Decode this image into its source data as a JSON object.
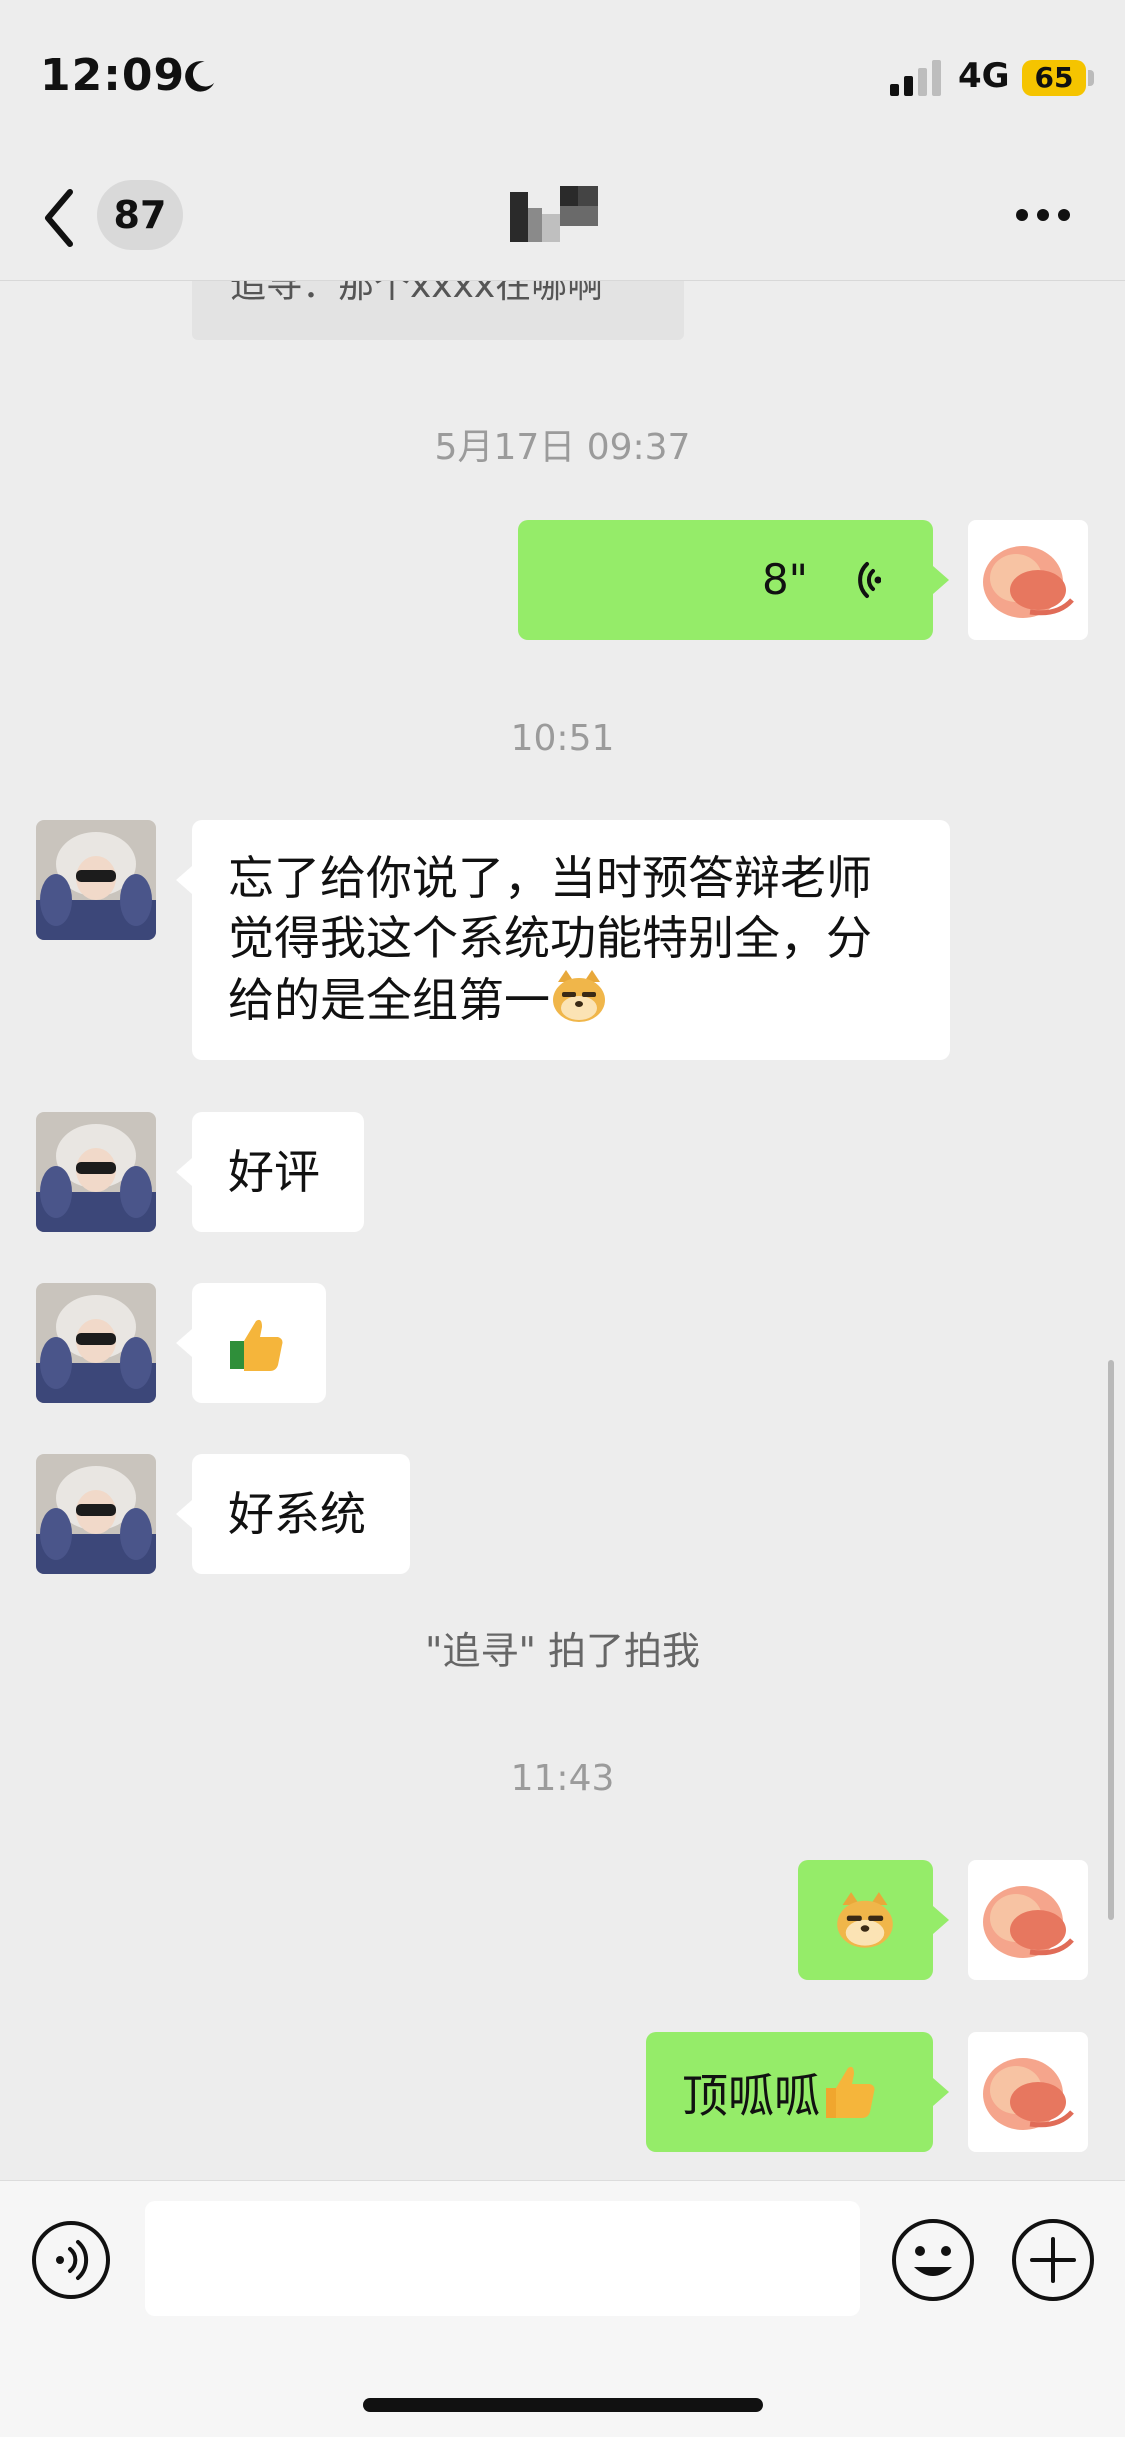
{
  "status_bar": {
    "time": "12:09",
    "network": "4G",
    "battery": "65"
  },
  "nav": {
    "unread_count": "87"
  },
  "quote": {
    "text": "追寻：那个xxxx在哪啊"
  },
  "messages": [
    {
      "kind": "timestamp",
      "text": "5月17日 09:37"
    },
    {
      "kind": "voice",
      "sender": "me",
      "duration": "8\""
    },
    {
      "kind": "timestamp",
      "text": "10:51"
    },
    {
      "kind": "text",
      "sender": "other",
      "lines": [
        "忘了给你说了，当时预答辩老师",
        "觉得我这个系统功能特别全，分",
        "给的是全组第一"
      ],
      "emoji": "doge-icon"
    },
    {
      "kind": "text",
      "sender": "other",
      "text": "好评"
    },
    {
      "kind": "emoji",
      "sender": "other",
      "emoji": "thumbs-up-icon"
    },
    {
      "kind": "text",
      "sender": "other",
      "text": "好系统"
    },
    {
      "kind": "system",
      "text": "\"追寻\" 拍了拍我"
    },
    {
      "kind": "timestamp",
      "text": "11:43"
    },
    {
      "kind": "emoji",
      "sender": "me",
      "emoji": "doge-icon"
    },
    {
      "kind": "text",
      "sender": "me",
      "text": "顶呱呱",
      "emoji": "thumbs-up-icon"
    }
  ],
  "colors": {
    "outgoing_bubble": "#95ec69",
    "incoming_bubble": "#ffffff",
    "background": "#ededed"
  }
}
